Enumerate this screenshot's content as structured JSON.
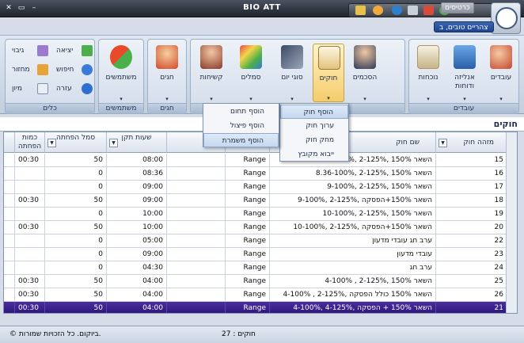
{
  "window": {
    "title": "BIO ATT"
  },
  "topbar": {
    "cards_label": "כרטיסים",
    "greeting": "צהריים טובים, ב"
  },
  "ribbon": {
    "groups": [
      {
        "label": "עובדים",
        "buttons": [
          {
            "label": "עובדים"
          },
          {
            "label": "אנליזה ודוחות"
          },
          {
            "label": "נוכחות"
          }
        ]
      },
      {
        "label": "",
        "buttons": [
          {
            "label": "הסכמים"
          },
          {
            "label": "חוקים"
          },
          {
            "label": "סוגי יום"
          },
          {
            "label": "סמלים"
          },
          {
            "label": "קשיחות"
          }
        ]
      },
      {
        "label": "חגים",
        "buttons": [
          {
            "label": "חגים"
          }
        ]
      },
      {
        "label": "משתמשים",
        "buttons": [
          {
            "label": "משתמשים"
          }
        ]
      },
      {
        "label": "כלים",
        "small": [
          {
            "label": "יציאה"
          },
          {
            "label": "גיבוי"
          },
          {
            "label": "חיפוש"
          },
          {
            "label": "מחזור"
          },
          {
            "label": "עזרה"
          },
          {
            "label": "מיון"
          }
        ]
      }
    ]
  },
  "dropdown_main": {
    "items": [
      "הוסף חוק",
      "ערוך חוק",
      "מחק חוק",
      "ייבוא מקובץ"
    ]
  },
  "dropdown_sub": {
    "items": [
      "הוסף תחום",
      "הוסף פיצול",
      "הוסף משמרת"
    ]
  },
  "section": {
    "title": "חוקים"
  },
  "table": {
    "columns": [
      "מזהה חוק",
      "שם חוק",
      "",
      "",
      "שעות תקן",
      "סמל הפחתה",
      "כמות הפחתה"
    ],
    "rows": [
      {
        "id": "15",
        "name": "8-100%, 2-125%, השאר 150%",
        "type": "Range",
        "hours": "08:00",
        "symbol": "50",
        "amount": "00:30"
      },
      {
        "id": "16",
        "name": "8.36-100%, 2-125%, השאר 150%",
        "type": "Range",
        "hours": "08:36",
        "symbol": "0",
        "amount": ""
      },
      {
        "id": "17",
        "name": "9-100%, 2-125%, השאר 150%",
        "type": "Range",
        "hours": "09:00",
        "symbol": "0",
        "amount": ""
      },
      {
        "id": "18",
        "name": "9-100%, 2-125%, השאר 150%+הפסקה",
        "type": "Range",
        "hours": "09:00",
        "symbol": "50",
        "amount": "00:30"
      },
      {
        "id": "19",
        "name": "10-100%, 2-125%, השאר 150%",
        "type": "Range",
        "hours": "10:00",
        "symbol": "0",
        "amount": ""
      },
      {
        "id": "20",
        "name": "10-100%, 2-125%, השאר 150%+הפסקה",
        "type": "Range",
        "hours": "10:00",
        "symbol": "50",
        "amount": "00:30"
      },
      {
        "id": "22",
        "name": "ערב חג עובדי מדעון",
        "type": "Range",
        "hours": "05:00",
        "symbol": "0",
        "amount": ""
      },
      {
        "id": "23",
        "name": "עובדי מדעון",
        "type": "Range",
        "hours": "09:00",
        "symbol": "0",
        "amount": ""
      },
      {
        "id": "24",
        "name": "ערב חג",
        "type": "Range",
        "hours": "04:30",
        "symbol": "0",
        "amount": ""
      },
      {
        "id": "25",
        "name": "4-100% , 2-125%, השאר 150%",
        "type": "Range",
        "hours": "04:00",
        "symbol": "50",
        "amount": "00:30"
      },
      {
        "id": "26",
        "name": "4-100% , 2-125%, השאר 150% כולל הפסקה",
        "type": "Range",
        "hours": "04:00",
        "symbol": "50",
        "amount": "00:30"
      },
      {
        "id": "21",
        "name": "4-100%, 4-125%, השאר 150% + הפסקה",
        "type": "Range",
        "hours": "04:00",
        "symbol": "50",
        "amount": "00:30"
      }
    ]
  },
  "status": {
    "count": "חוקים : 27",
    "copyright": "© ביוקום. כל הזכויות שמורות."
  }
}
